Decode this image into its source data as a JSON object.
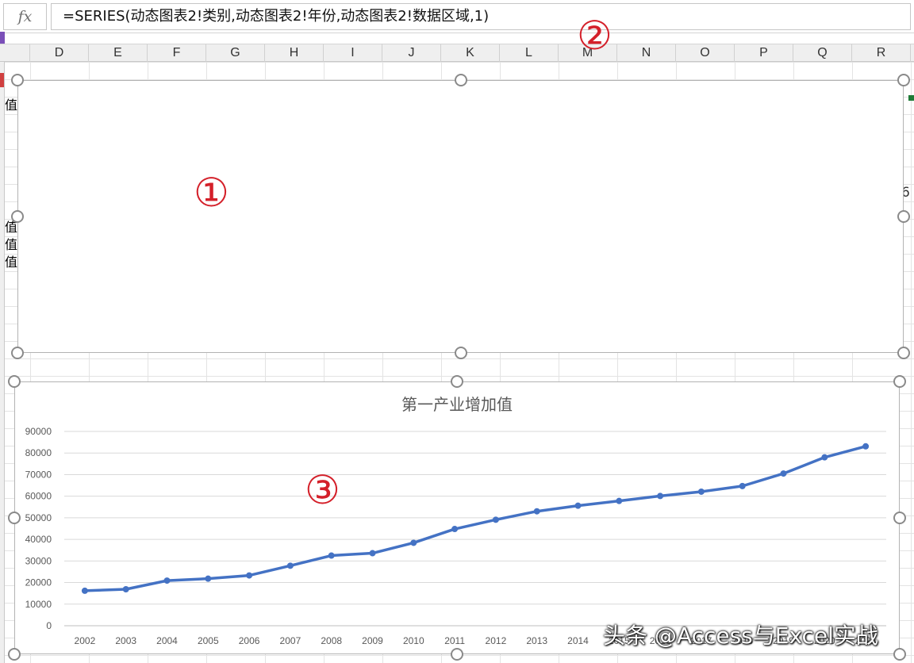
{
  "formula_bar": {
    "fx_label": "fx",
    "formula": "=SERIES(动态图表2!类别,动态图表2!年份,动态图表2!数据区域,1)"
  },
  "columns": [
    "D",
    "E",
    "F",
    "G",
    "H",
    "I",
    "J",
    "K",
    "L",
    "M",
    "N",
    "O",
    "P",
    "Q",
    "R"
  ],
  "cells": {
    "left_values": [
      "值",
      "值",
      "值",
      "值"
    ],
    "right_partial": "6"
  },
  "annotations": {
    "marker_1": "①",
    "marker_2": "②",
    "marker_3": "③"
  },
  "chart_data": {
    "type": "line",
    "title": "第一产业增加值",
    "categories": [
      "2002",
      "2003",
      "2004",
      "2005",
      "2006",
      "2007",
      "2008",
      "2009",
      "2010",
      "2011",
      "2012",
      "2013",
      "2014",
      "2015",
      "2016",
      "2017",
      "2018",
      "2019",
      "2020",
      "2021"
    ],
    "series": [
      {
        "values": [
          16200,
          16900,
          20900,
          21800,
          23300,
          27800,
          32500,
          33600,
          38400,
          44800,
          49100,
          53000,
          55600,
          57800,
          60100,
          62100,
          64700,
          70500,
          78000,
          83100
        ]
      }
    ],
    "ylim": [
      0,
      90000
    ],
    "yticks": [
      0,
      10000,
      20000,
      30000,
      40000,
      50000,
      60000,
      70000,
      80000,
      90000
    ],
    "grid": true,
    "color": "#4472c4"
  },
  "watermark": "头条 @Access与Excel实战"
}
